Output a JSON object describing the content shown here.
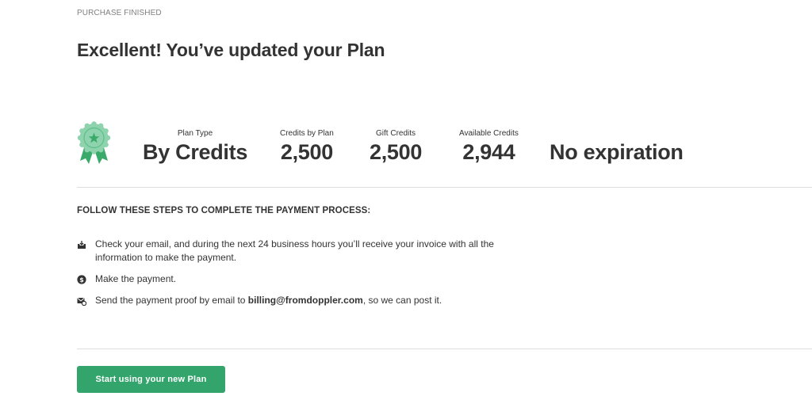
{
  "header": {
    "breadcrumb": "PURCHASE FINISHED",
    "title": "Excellent! You’ve updated your Plan"
  },
  "plan_summary": {
    "badge_icon": "award-ribbon-icon",
    "plan_type": {
      "label": "Plan Type",
      "value": "By Credits"
    },
    "credits_by_plan": {
      "label": "Credits by Plan",
      "value": "2,500"
    },
    "gift_credits": {
      "label": "Gift Credits",
      "value": "2,500"
    },
    "available_credits": {
      "label": "Available Credits",
      "value": "2,944"
    },
    "expiration": {
      "value": "No expiration"
    }
  },
  "steps": {
    "heading": "FOLLOW THESE STEPS TO COMPLETE THE PAYMENT PROCESS:",
    "items": [
      {
        "icon": "inbox-mail-icon",
        "text": "Check your email, and during the next 24 business hours you’ll receive your invoice with all the information to make the payment."
      },
      {
        "icon": "dollar-coin-icon",
        "text": "Make the payment."
      },
      {
        "icon": "mail-send-icon",
        "text_before": "Send the payment proof by email to ",
        "email": "billing@fromdoppler.com",
        "text_after": ", so we can post it."
      }
    ]
  },
  "cta": {
    "label": "Start using your new Plan"
  },
  "colors": {
    "accent_green": "#33a46b",
    "badge_light_green": "#8ed3ad",
    "badge_dark_green": "#3aaa6b",
    "text": "#333333",
    "muted": "#808080",
    "divider": "#dddddd"
  }
}
